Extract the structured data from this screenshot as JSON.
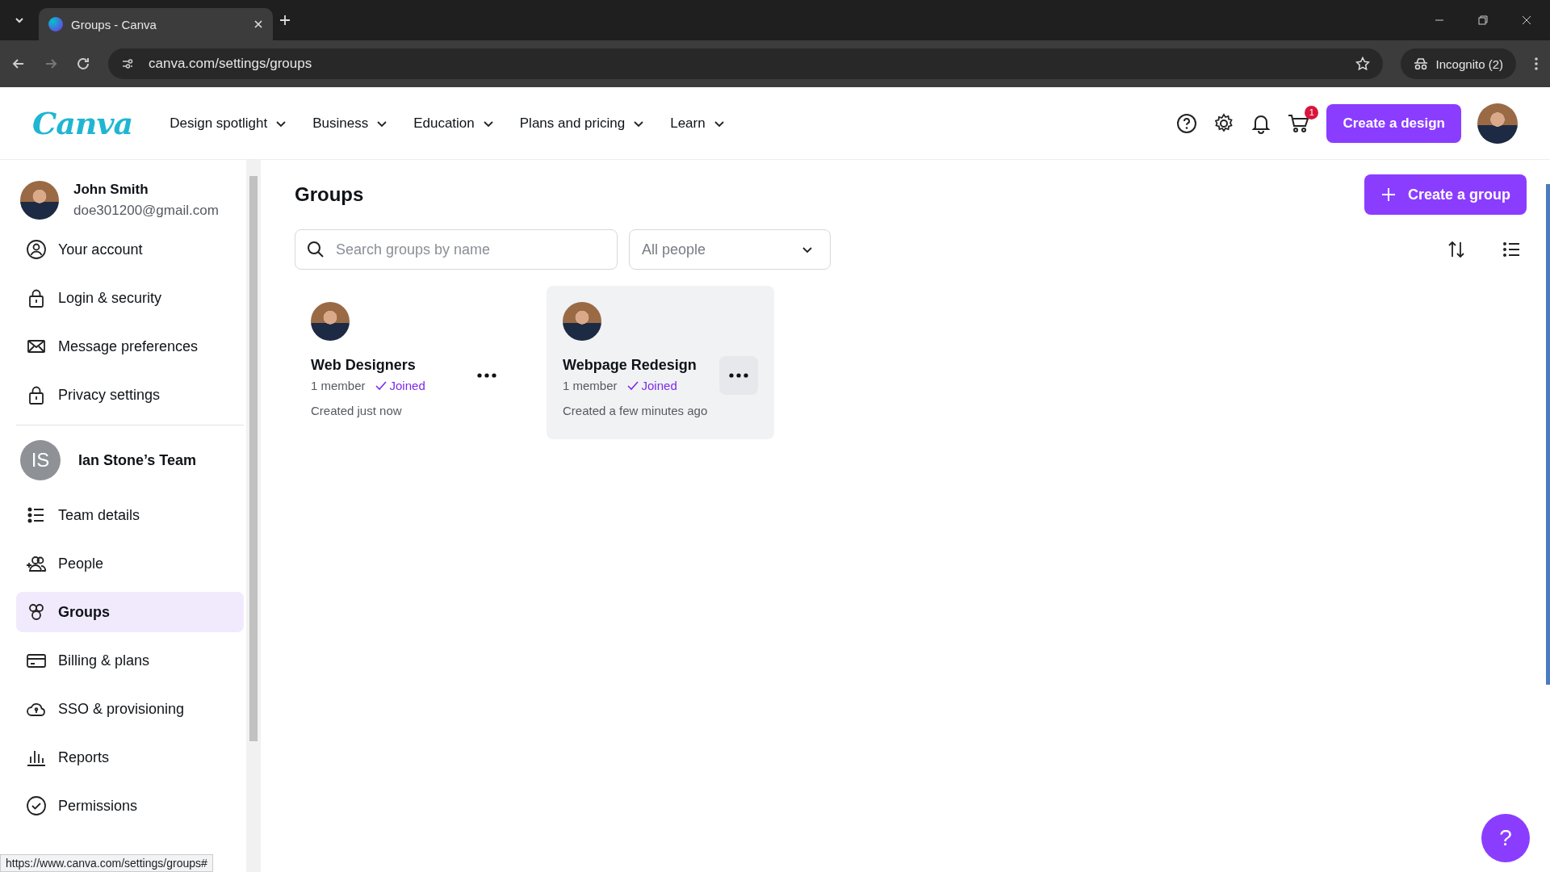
{
  "browser": {
    "tab_title": "Groups - Canva",
    "url": "canva.com/settings/groups",
    "incognito": "Incognito (2)",
    "status_url": "https://www.canva.com/settings/groups#"
  },
  "header": {
    "logo": "Canva",
    "nav": [
      "Design spotlight",
      "Business",
      "Education",
      "Plans and pricing",
      "Learn"
    ],
    "cart_count": "1",
    "create_button": "Create a design"
  },
  "sidebar": {
    "user": {
      "name": "John Smith",
      "email": "doe301200@gmail.com"
    },
    "account_items": [
      {
        "label": "Your account",
        "kind": "account",
        "selected": false
      },
      {
        "label": "Login & security",
        "kind": "lock",
        "selected": false
      },
      {
        "label": "Message preferences",
        "kind": "mail",
        "selected": false
      },
      {
        "label": "Privacy settings",
        "kind": "lock",
        "selected": false
      }
    ],
    "team": {
      "initials": "IS",
      "name": "Ian Stone’s Team"
    },
    "team_items": [
      {
        "label": "Team details",
        "kind": "list",
        "selected": false
      },
      {
        "label": "People",
        "kind": "people",
        "selected": false
      },
      {
        "label": "Groups",
        "kind": "groups",
        "selected": true
      },
      {
        "label": "Billing & plans",
        "kind": "card",
        "selected": false
      },
      {
        "label": "SSO & provisioning",
        "kind": "cloud",
        "selected": false
      },
      {
        "label": "Reports",
        "kind": "chart",
        "selected": false
      },
      {
        "label": "Permissions",
        "kind": "check",
        "selected": false
      }
    ]
  },
  "main": {
    "title": "Groups",
    "create_button": "Create a group",
    "search": {
      "placeholder": "Search groups by name"
    },
    "filter": "All people",
    "groups": [
      {
        "name": "Web Designers",
        "members": "1 member",
        "status": "Joined",
        "created": "Created just now",
        "highlighted": false
      },
      {
        "name": "Webpage Redesign",
        "members": "1 member",
        "status": "Joined",
        "created": "Created a few minutes ago",
        "highlighted": true
      }
    ],
    "help_button": "?"
  }
}
